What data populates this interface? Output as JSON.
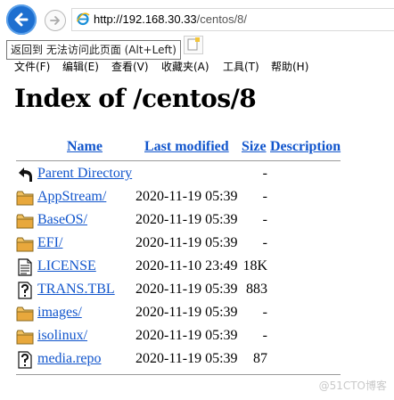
{
  "browser": {
    "url_domain": "http://192.168.30.33",
    "url_path": "/centos/8/",
    "tooltip": "返回到 无法访问此页面 (Alt+Left)"
  },
  "menu": [
    "文件(F)",
    "编辑(E)",
    "查看(V)",
    "收藏夹(A)",
    "工具(T)",
    "帮助(H)"
  ],
  "page": {
    "title": "Index of /centos/8",
    "columns": {
      "name": "Name",
      "modified": "Last modified",
      "size": "Size",
      "description": "Description"
    },
    "entries": [
      {
        "name": "Parent Directory",
        "date": "",
        "size": "-",
        "icon": "back-icon"
      },
      {
        "name": "AppStream/",
        "date": "2020-11-19 05:39",
        "size": "-",
        "icon": "folder-icon"
      },
      {
        "name": "BaseOS/",
        "date": "2020-11-19 05:39",
        "size": "-",
        "icon": "folder-icon"
      },
      {
        "name": "EFI/",
        "date": "2020-11-19 05:39",
        "size": "-",
        "icon": "folder-icon"
      },
      {
        "name": "LICENSE",
        "date": "2020-11-10 23:49",
        "size": "18K",
        "icon": "text-file-icon"
      },
      {
        "name": "TRANS.TBL",
        "date": "2020-11-19 05:39",
        "size": "883",
        "icon": "unknown-file-icon"
      },
      {
        "name": "images/",
        "date": "2020-11-19 05:39",
        "size": "-",
        "icon": "folder-icon"
      },
      {
        "name": "isolinux/",
        "date": "2020-11-19 05:39",
        "size": "-",
        "icon": "folder-icon"
      },
      {
        "name": "media.repo",
        "date": "2020-11-19 05:39",
        "size": "87",
        "icon": "unknown-file-icon"
      }
    ]
  },
  "watermark": "@51CTO博客"
}
